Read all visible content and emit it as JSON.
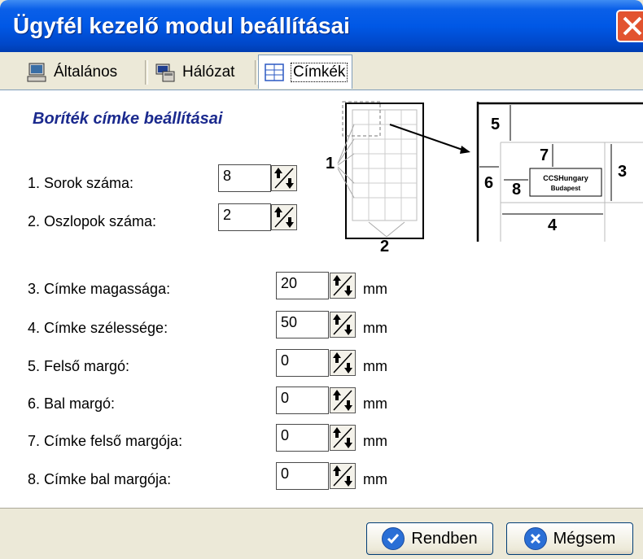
{
  "window": {
    "title": "Ügyfél kezelő modul beállításai",
    "accent": "#0058e6"
  },
  "tabs": [
    {
      "label": "Általános",
      "icon": "computer-icon",
      "active": false
    },
    {
      "label": "Hálózat",
      "icon": "network-icon",
      "active": false
    },
    {
      "label": "Címkék",
      "icon": "labels-icon",
      "active": true
    }
  ],
  "section": {
    "title": "Boríték címke beállításai"
  },
  "fields": [
    {
      "label": "1. Sorok száma:",
      "value": "8",
      "unit": ""
    },
    {
      "label": "2. Oszlopok száma:",
      "value": "2",
      "unit": ""
    },
    {
      "label": "3. Címke magassága:",
      "value": "20",
      "unit": "mm"
    },
    {
      "label": "4. Címke szélessége:",
      "value": "50",
      "unit": "mm"
    },
    {
      "label": "5. Felső margó:",
      "value": "0",
      "unit": "mm"
    },
    {
      "label": "6. Bal margó:",
      "value": "0",
      "unit": "mm"
    },
    {
      "label": "7. Címke felső margója:",
      "value": "0",
      "unit": "mm"
    },
    {
      "label": "8. Címke bal margója:",
      "value": "0",
      "unit": "mm"
    }
  ],
  "diagram": {
    "numbers": [
      "1",
      "2",
      "3",
      "4",
      "5",
      "6",
      "7",
      "8"
    ],
    "sample_label_line1": "CCSHungary",
    "sample_label_line2": "Budapest"
  },
  "buttons": {
    "ok": "Rendben",
    "cancel": "Mégsem"
  }
}
